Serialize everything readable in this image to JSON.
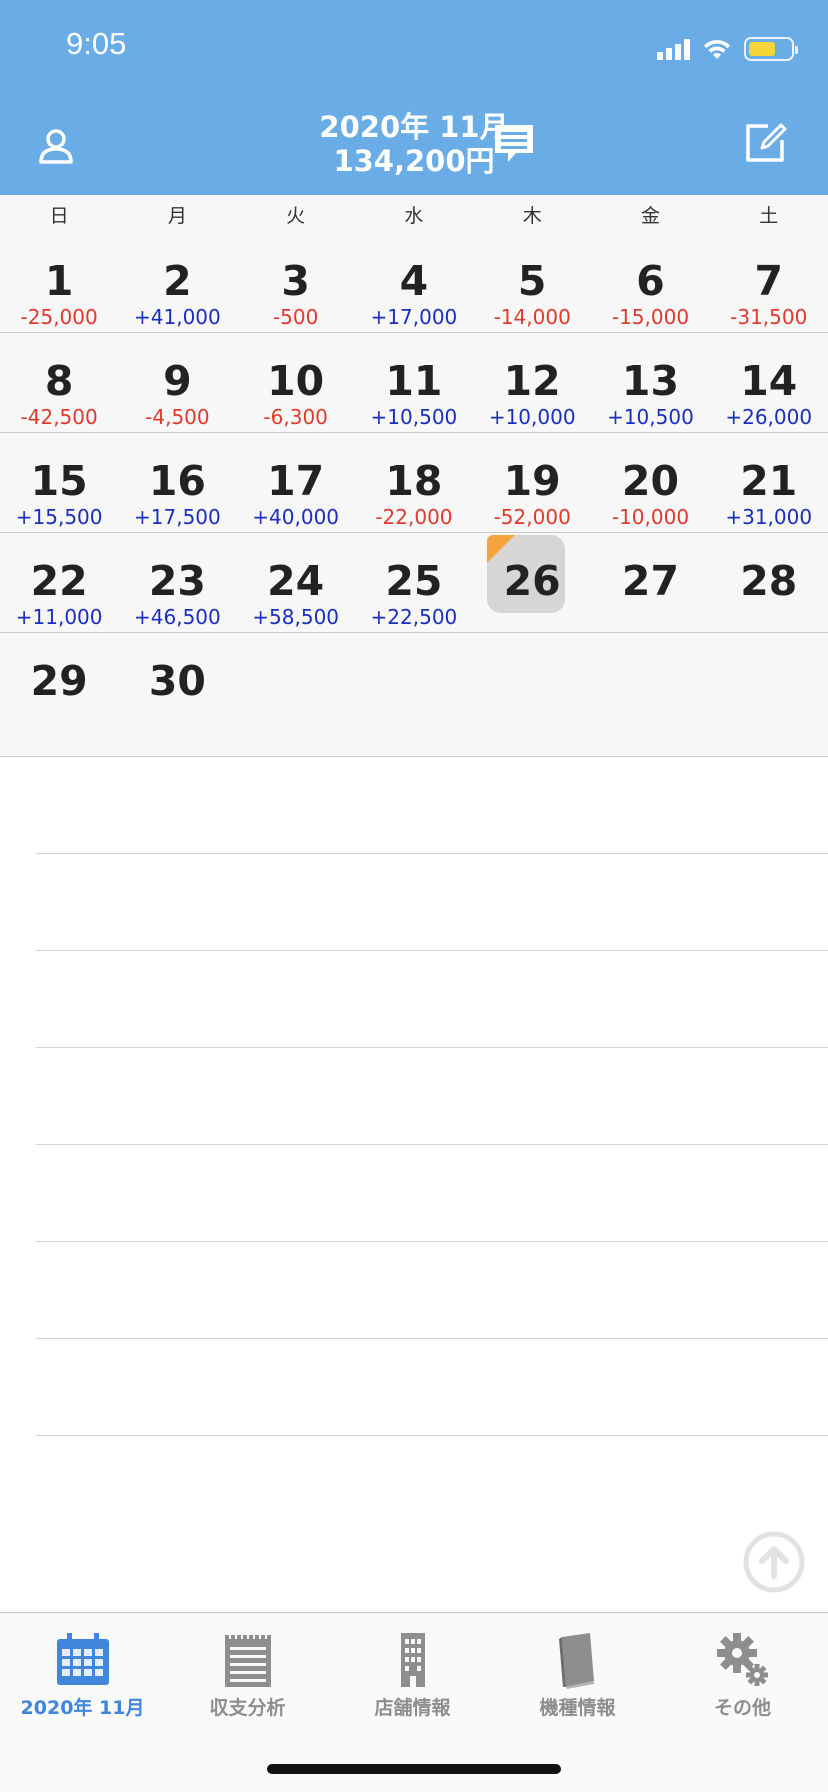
{
  "status": {
    "time": "9:05"
  },
  "header": {
    "title": "2020年 11月",
    "total": "134,200円",
    "user_icon": "user-icon",
    "chat_icon": "chat-icon",
    "edit_icon": "edit-icon"
  },
  "weekdays": [
    "日",
    "月",
    "火",
    "水",
    "木",
    "金",
    "土"
  ],
  "weeks": [
    [
      {
        "day": "1",
        "amount": "-25,000"
      },
      {
        "day": "2",
        "amount": "+41,000"
      },
      {
        "day": "3",
        "amount": "-500"
      },
      {
        "day": "4",
        "amount": "+17,000"
      },
      {
        "day": "5",
        "amount": "-14,000"
      },
      {
        "day": "6",
        "amount": "-15,000"
      },
      {
        "day": "7",
        "amount": "-31,500"
      }
    ],
    [
      {
        "day": "8",
        "amount": "-42,500"
      },
      {
        "day": "9",
        "amount": "-4,500"
      },
      {
        "day": "10",
        "amount": "-6,300"
      },
      {
        "day": "11",
        "amount": "+10,500"
      },
      {
        "day": "12",
        "amount": "+10,000"
      },
      {
        "day": "13",
        "amount": "+10,500"
      },
      {
        "day": "14",
        "amount": "+26,000"
      }
    ],
    [
      {
        "day": "15",
        "amount": "+15,500"
      },
      {
        "day": "16",
        "amount": "+17,500"
      },
      {
        "day": "17",
        "amount": "+40,000"
      },
      {
        "day": "18",
        "amount": "-22,000"
      },
      {
        "day": "19",
        "amount": "-52,000"
      },
      {
        "day": "20",
        "amount": "-10,000"
      },
      {
        "day": "21",
        "amount": "+31,000"
      }
    ],
    [
      {
        "day": "22",
        "amount": "+11,000"
      },
      {
        "day": "23",
        "amount": "+46,500"
      },
      {
        "day": "24",
        "amount": "+58,500"
      },
      {
        "day": "25",
        "amount": "+22,500"
      },
      {
        "day": "26",
        "amount": "",
        "today": true
      },
      {
        "day": "27",
        "amount": ""
      },
      {
        "day": "28",
        "amount": ""
      }
    ],
    [
      {
        "day": "29",
        "amount": ""
      },
      {
        "day": "30",
        "amount": ""
      },
      {
        "day": "",
        "amount": ""
      },
      {
        "day": "",
        "amount": ""
      },
      {
        "day": "",
        "amount": ""
      },
      {
        "day": "",
        "amount": ""
      },
      {
        "day": "",
        "amount": ""
      }
    ]
  ],
  "colors": {
    "positive": "#1a2fbf",
    "negative": "#e03a2e",
    "header": "#6aace5",
    "today_marker": "#f5a43b",
    "active_tab": "#3f86dc"
  },
  "tabs": [
    {
      "label": "2020年 11月",
      "icon": "calendar-icon",
      "active": true
    },
    {
      "label": "収支分析",
      "icon": "notepad-icon",
      "active": false
    },
    {
      "label": "店舗情報",
      "icon": "building-icon",
      "active": false
    },
    {
      "label": "機種情報",
      "icon": "book-icon",
      "active": false
    },
    {
      "label": "その他",
      "icon": "gear-icon",
      "active": false
    }
  ],
  "scroll_top_icon": "arrow-up-circle-icon"
}
